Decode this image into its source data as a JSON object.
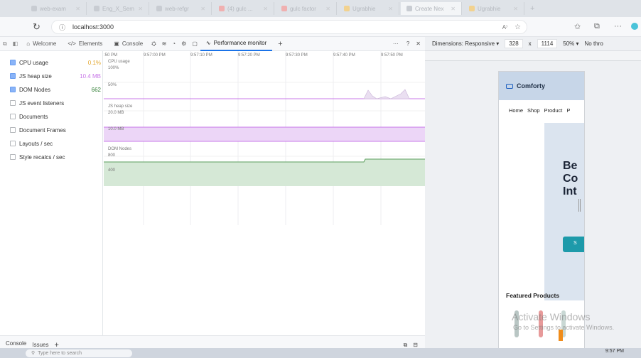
{
  "browser": {
    "tabs": [
      {
        "label": "web-exam",
        "favicon": "gray"
      },
      {
        "label": "Eng_X_Sem",
        "favicon": "gray"
      },
      {
        "label": "web-refgr",
        "favicon": "gray"
      },
      {
        "label": "(4) gulc ...",
        "favicon": "red"
      },
      {
        "label": "gulc factor",
        "favicon": "red"
      },
      {
        "label": "Ugrabhie",
        "favicon": "yellow"
      },
      {
        "label": "Create Nex",
        "favicon": "gray",
        "active": true
      },
      {
        "label": "Ugrabhie",
        "favicon": "yellow"
      }
    ],
    "new_tab": "+",
    "address": "localhost:3000"
  },
  "devtools": {
    "tabs": [
      {
        "label": "Welcome",
        "icon": "home-icon"
      },
      {
        "label": "Elements",
        "icon": "code-icon"
      },
      {
        "label": "Console",
        "icon": "console-icon"
      },
      {
        "label": "Performance monitor",
        "icon": "activity-icon",
        "active": true
      }
    ],
    "add_tab": "+",
    "more": "···",
    "help": "?",
    "close": "✕",
    "metrics": [
      {
        "label": "CPU usage",
        "value": "0.1%",
        "checked": true,
        "color": "#e3a72f"
      },
      {
        "label": "JS heap size",
        "value": "10.4 MB",
        "checked": true,
        "color": "#c878e8"
      },
      {
        "label": "DOM Nodes",
        "value": "662",
        "checked": true,
        "color": "#2e7d32"
      },
      {
        "label": "JS event listeners",
        "value": "",
        "checked": false,
        "color": ""
      },
      {
        "label": "Documents",
        "value": "",
        "checked": false,
        "color": ""
      },
      {
        "label": "Document Frames",
        "value": "",
        "checked": false,
        "color": ""
      },
      {
        "label": "Layouts / sec",
        "value": "",
        "checked": false,
        "color": ""
      },
      {
        "label": "Style recalcs / sec",
        "value": "",
        "checked": false,
        "color": ""
      }
    ],
    "times": [
      ":50 PM",
      "9:57:00 PM",
      "9:57:10 PM",
      "9:57:20 PM",
      "9:57:30 PM",
      "9:57:40 PM",
      "9:57:50 PM"
    ],
    "graph_labels": {
      "cpu_title": "CPU usage",
      "cpu_100": "100%",
      "cpu_50": "50%",
      "heap_title": "JS heap size",
      "heap_20": "20.0 MB",
      "heap_10": "10.0 MB",
      "dom_title": "DOM Nodes",
      "dom_800": "800",
      "dom_400": "400"
    },
    "bottom_tabs": [
      "Console",
      "Issues"
    ],
    "bottom_add": "+"
  },
  "device": {
    "dimensions_label": "Dimensions: Responsive",
    "width": "328",
    "x": "x",
    "height": "1114",
    "zoom": "50%",
    "throttle": "No thro"
  },
  "site": {
    "brand": "Comforty",
    "nav": [
      "Home",
      "Shop",
      "Product",
      "P"
    ],
    "hero_lines": [
      "Be",
      "Co",
      "Int"
    ],
    "button_text": "S",
    "featured": "Featured Products"
  },
  "os": {
    "watermark_title": "Activate Windows",
    "watermark_sub": "Go to Settings to activate Windows.",
    "search_placeholder": "Type here to search",
    "clock": "9:57 PM"
  }
}
